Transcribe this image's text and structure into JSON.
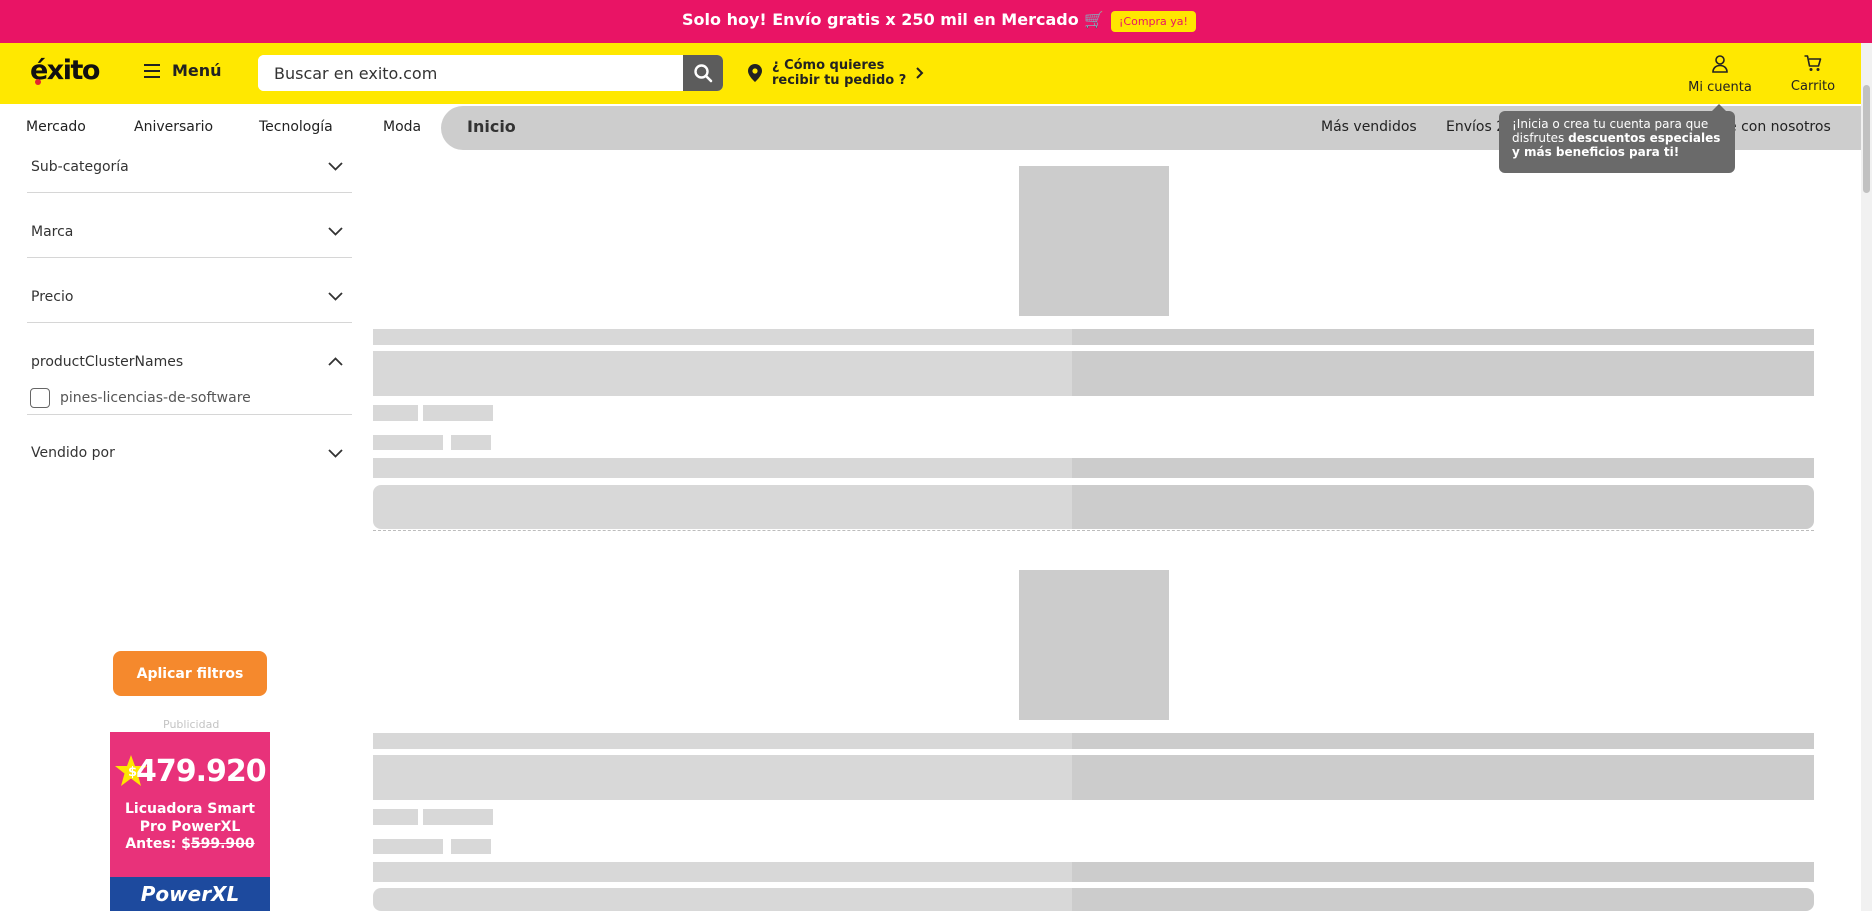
{
  "promo": {
    "text": "Solo hoy! Envío gratis x 250 mil en Mercado 🛒",
    "button": "¡Compra ya!"
  },
  "header": {
    "logo": "éxito",
    "menu_label": "Menú",
    "search_placeholder": "Buscar en exito.com",
    "delivery_line1": "¿ Cómo quieres",
    "delivery_line2": "recibir tu pedido ?",
    "account_label": "Mi cuenta",
    "cart_label": "Carrito"
  },
  "nav": {
    "items": [
      "Mercado",
      "Aniversario",
      "Tecnología",
      "Moda"
    ],
    "active": "Inicio",
    "right_items": [
      "Más vendidos",
      "Envíos 2",
      "e con nosotros"
    ]
  },
  "tooltip": {
    "text_plain": "¡Inicia o crea tu cuenta para que disfrutes ",
    "text_bold": "descuentos especiales y más beneficios para ti!"
  },
  "filters": [
    {
      "label": "Sub-categoría",
      "expanded": false
    },
    {
      "label": "Marca",
      "expanded": false
    },
    {
      "label": "Precio",
      "expanded": false
    },
    {
      "label": "productClusterNames",
      "expanded": true
    },
    {
      "label": "Vendido por",
      "expanded": false
    }
  ],
  "cluster_option": {
    "label": "pines-licencias-de-software",
    "checked": false
  },
  "apply_button": "Aplicar filtros",
  "ad": {
    "label": "Publicidad",
    "currency": "$",
    "price": "479.920",
    "product": "Licuadora Smart Pro PowerXL",
    "before_label": "Antes: $",
    "before_price": "599.900",
    "brand": "PowerXL"
  },
  "colors": {
    "promo_bg": "#e91465",
    "header_bg": "#ffe800",
    "apply_btn": "#f5892d",
    "skeleton": "#d8d8d8"
  }
}
